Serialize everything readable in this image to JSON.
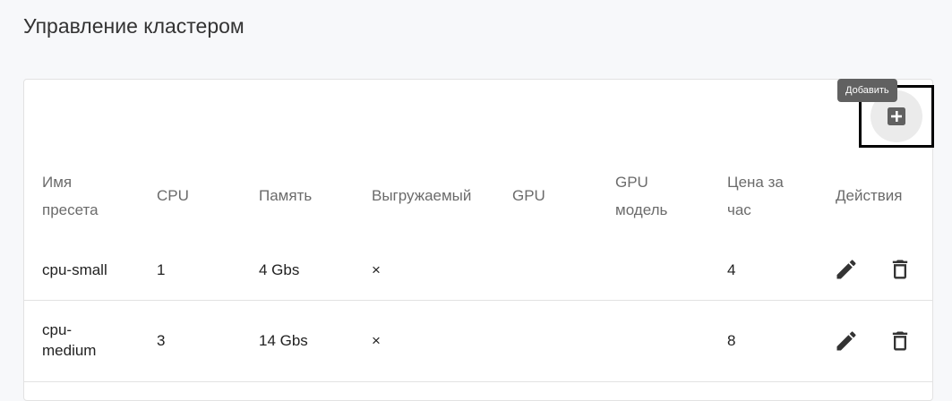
{
  "page": {
    "title": "Управление кластером"
  },
  "toolbar": {
    "add_tooltip": "Добавить"
  },
  "table": {
    "columns": {
      "name_line1": "Имя",
      "name_line2": "пресета",
      "cpu": "CPU",
      "memory": "Память",
      "preemptible": "Выгружаемый",
      "gpu": "GPU",
      "gpu_model_line1": "GPU",
      "gpu_model_line2": "модель",
      "price_line1": "Цена за",
      "price_line2": "час",
      "actions": "Действия"
    },
    "rows": [
      {
        "name_line1": "cpu-small",
        "name_line2": "",
        "cpu": "1",
        "memory": "4 Gbs",
        "preemptible": "×",
        "gpu": "",
        "gpu_model": "",
        "price": "4"
      },
      {
        "name_line1": "cpu-",
        "name_line2": "medium",
        "cpu": "3",
        "memory": "14 Gbs",
        "preemptible": "×",
        "gpu": "",
        "gpu_model": "",
        "price": "8"
      }
    ]
  },
  "colors": {
    "icon": "#333333",
    "add_icon": "#616161",
    "tooltip_bg": "#616161",
    "page_bg": "#f7f8fa"
  },
  "icons": {
    "add": "plus-box-icon",
    "edit": "pencil-icon",
    "delete": "trash-icon"
  }
}
